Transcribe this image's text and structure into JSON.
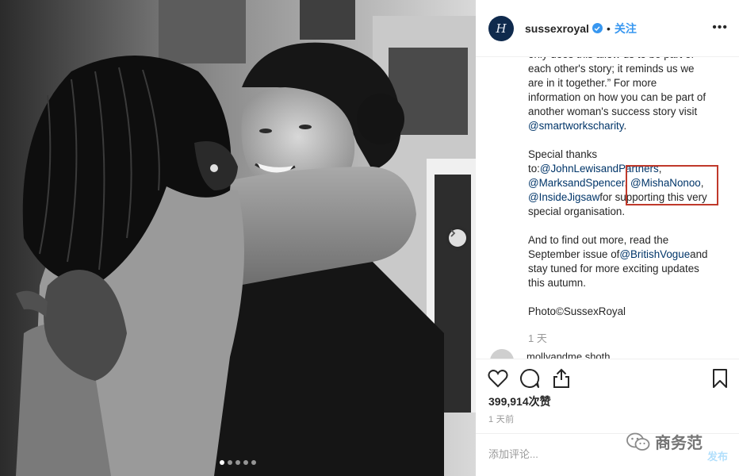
{
  "post": {
    "username": "sussexroyal",
    "avatar_letter": "H",
    "follow_label": "关注",
    "separator": "•",
    "more_label": "•••"
  },
  "caption": {
    "lines": [
      [
        "each other's story; it reminds us we"
      ],
      [
        "are in it together.” For more"
      ],
      [
        "information on how you can be part of"
      ],
      [
        "another woman's success story visit"
      ]
    ],
    "p1_line0": "only does this allow us to be part of",
    "p1_line1": "each other's story; it reminds us we",
    "p1_line2": "are in it together.” For more",
    "p1_line3": "information on how you can be part of",
    "p1_line4": "another woman's success story visit",
    "p1_mention": "@smartworkscharity",
    "p1_end": ".",
    "p2_line0": "Special thanks",
    "p2_to": "to:",
    "p2_m1": "@JohnLewisandPartners",
    "p2_comma1": ",",
    "p2_m2": "@MarksandSpencer",
    "p2_comma2": ", ",
    "p2_m3": "@MishaNonoo",
    "p2_comma3": ",",
    "p2_m4": "@InsideJigsaw",
    "p2_after": "for supporting this very",
    "p2_line_end": "special organisation.",
    "p3_line0": "And to find out more, read the",
    "p3_pre": "September issue of",
    "p3_mention": "@BritishVogue",
    "p3_post": "and",
    "p3_line2": "stay tuned for more exciting updates",
    "p3_line3": "this autumn.",
    "p4_line0": "Photo©SussexRoyal",
    "age": "1 天"
  },
  "comment_preview": {
    "text": "mollyandme.shoth..."
  },
  "actions": {
    "like_icon": "heart-icon",
    "comment_icon": "comment-icon",
    "share_icon": "share-icon",
    "save_icon": "bookmark-icon",
    "likes_label": "399,914次赞",
    "age_label": "1 天前"
  },
  "comment_bar": {
    "placeholder": "添加评论...",
    "post_label": "发布"
  },
  "carousel": {
    "dot_count": 5,
    "active_index": 0
  },
  "watermark": {
    "text": "商务范"
  },
  "colors": {
    "accent": "#3897f0",
    "mention": "#003569",
    "highlight": "#c0392b"
  }
}
